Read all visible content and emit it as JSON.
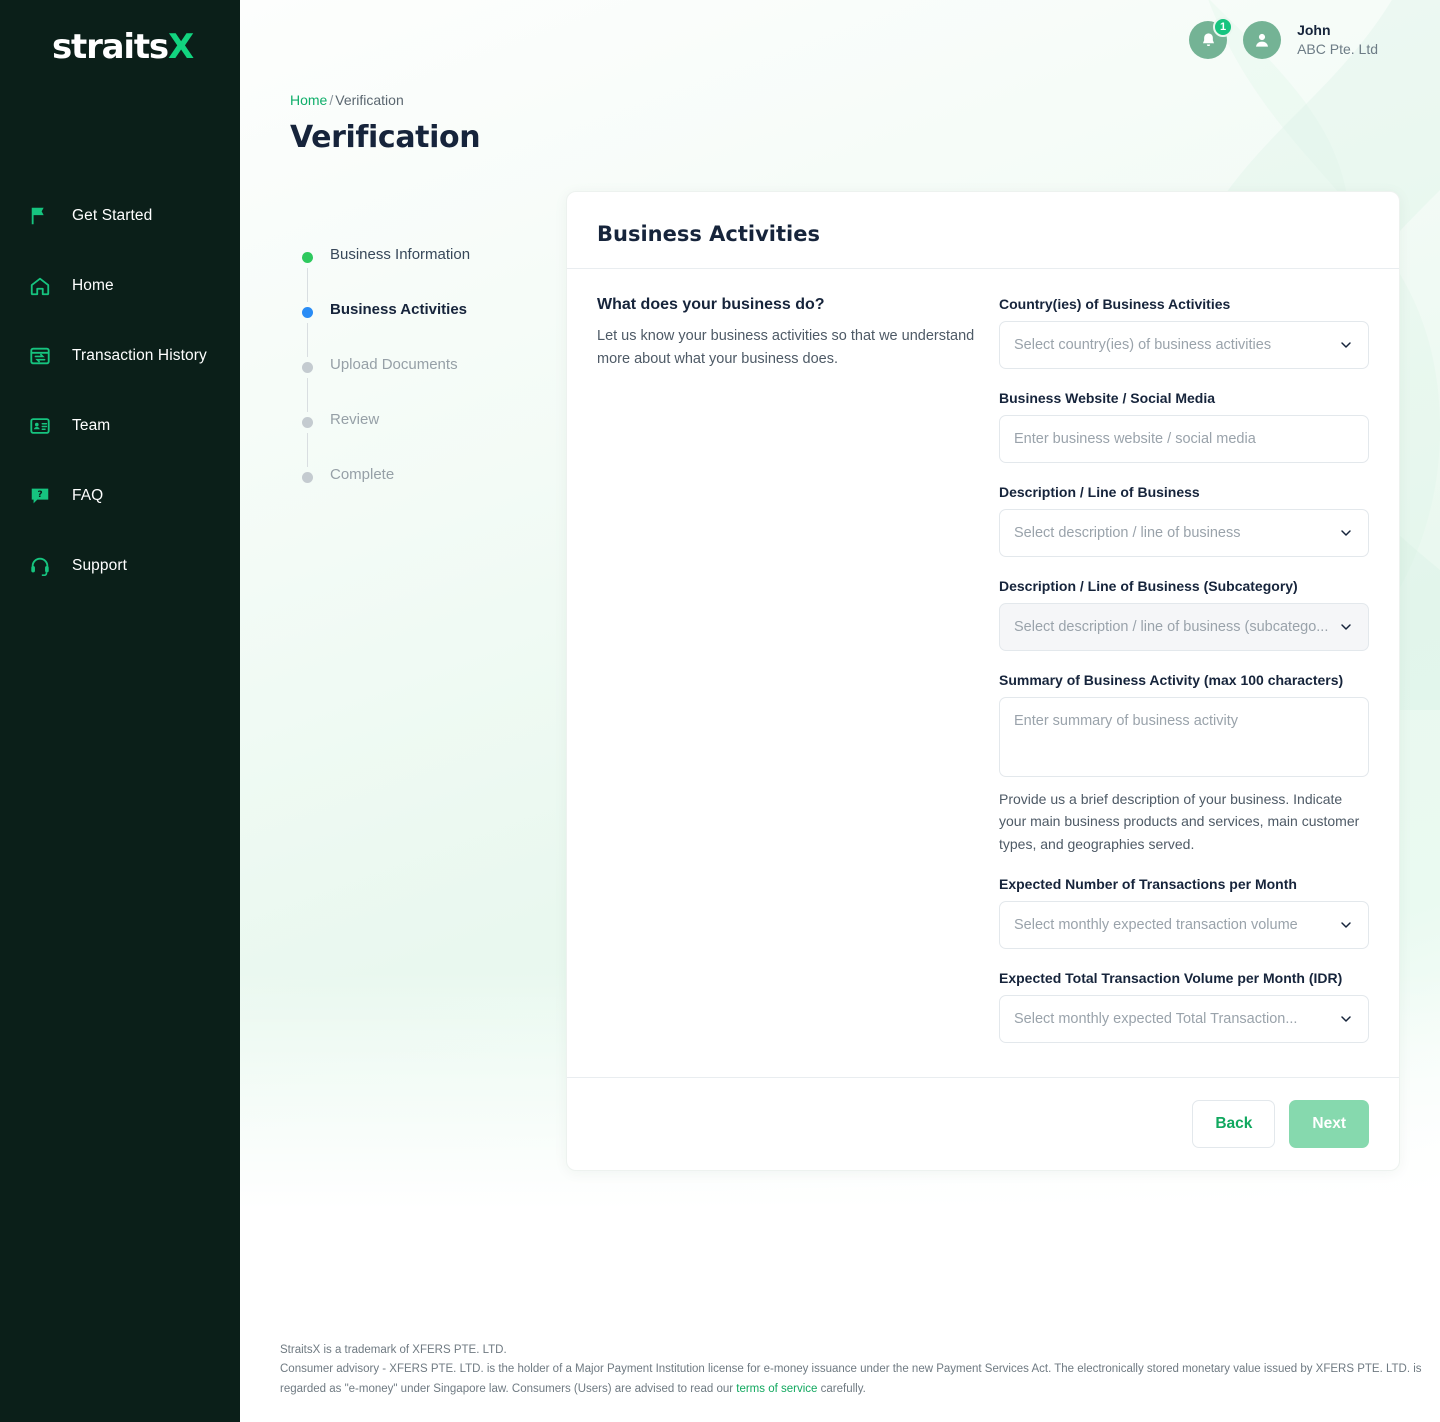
{
  "brand": {
    "logo_text": "straits",
    "logo_accent": "X",
    "accent_color": "#12d47f",
    "sidebar_bg": "#0b1f19"
  },
  "sidebar": {
    "items": [
      {
        "label": "Get Started",
        "icon": "flag-icon"
      },
      {
        "label": "Home",
        "icon": "home-icon"
      },
      {
        "label": "Transaction History",
        "icon": "transaction-history-icon"
      },
      {
        "label": "Team",
        "icon": "team-card-icon"
      },
      {
        "label": "FAQ",
        "icon": "faq-icon"
      },
      {
        "label": "Support",
        "icon": "headset-icon"
      }
    ]
  },
  "header": {
    "notification_count": "1",
    "user_name": "John",
    "user_org": "ABC Pte. Ltd"
  },
  "breadcrumb": {
    "home": "Home",
    "separator": "/",
    "current": "Verification"
  },
  "page": {
    "title": "Verification"
  },
  "stepper": {
    "steps": [
      {
        "label": "Business Information",
        "state": "done"
      },
      {
        "label": "Business Activities",
        "state": "current"
      },
      {
        "label": "Upload Documents",
        "state": "pending"
      },
      {
        "label": "Review",
        "state": "pending"
      },
      {
        "label": "Complete",
        "state": "pending"
      }
    ]
  },
  "card": {
    "title": "Business Activities",
    "question_title": "What does your business do?",
    "question_desc": "Let us know your business activities so that we understand more about what your business does.",
    "fields": [
      {
        "label": "Country(ies) of Business Activities",
        "placeholder": "Select country(ies) of business activities",
        "type": "select",
        "value": "",
        "disabled": false,
        "name": "country-of-business-activities"
      },
      {
        "label": "Business Website / Social Media",
        "placeholder": "Enter business website / social media",
        "type": "text",
        "value": "",
        "disabled": false,
        "name": "business-website-social-media"
      },
      {
        "label": "Description / Line of Business",
        "placeholder": "Select description / line of business",
        "type": "select",
        "value": "",
        "disabled": false,
        "name": "description-line-of-business"
      },
      {
        "label": "Description / Line of Business (Subcategory)",
        "placeholder": "Select description / line of business (subcatego...",
        "type": "select",
        "value": "",
        "disabled": true,
        "name": "description-line-of-business-subcategory"
      },
      {
        "label": "Summary of Business Activity (max 100 characters)",
        "placeholder": "Enter summary of business activity",
        "type": "textarea",
        "value": "",
        "disabled": false,
        "hint": "Provide us a brief description of your business. Indicate your main business products and services, main customer types, and geographies served.",
        "name": "summary-of-business-activity"
      },
      {
        "label": "Expected Number of Transactions per Month",
        "placeholder": "Select monthly expected transaction volume",
        "type": "select",
        "value": "",
        "disabled": false,
        "name": "expected-number-of-transactions-per-month"
      },
      {
        "label": "Expected Total Transaction Volume per Month (IDR)",
        "placeholder": "Select monthly expected Total Transaction...",
        "type": "select",
        "value": "",
        "disabled": false,
        "name": "expected-total-transaction-volume-per-month"
      }
    ],
    "back_label": "Back",
    "next_label": "Next",
    "next_disabled": true
  },
  "footer": {
    "line1": "StraitsX is a trademark of XFERS PTE. LTD.",
    "line2_part1": "Consumer advisory - XFERS PTE. LTD. is the holder of a Major Payment Institution license for e-money issuance under the new Payment Services Act. The electronically stored monetary value issued by XFERS PTE. LTD. is regarded as \"e-money\" under Singapore law. Consumers (Users) are advised to read our ",
    "link_text": "terms of service",
    "line2_part2": " carefully."
  }
}
